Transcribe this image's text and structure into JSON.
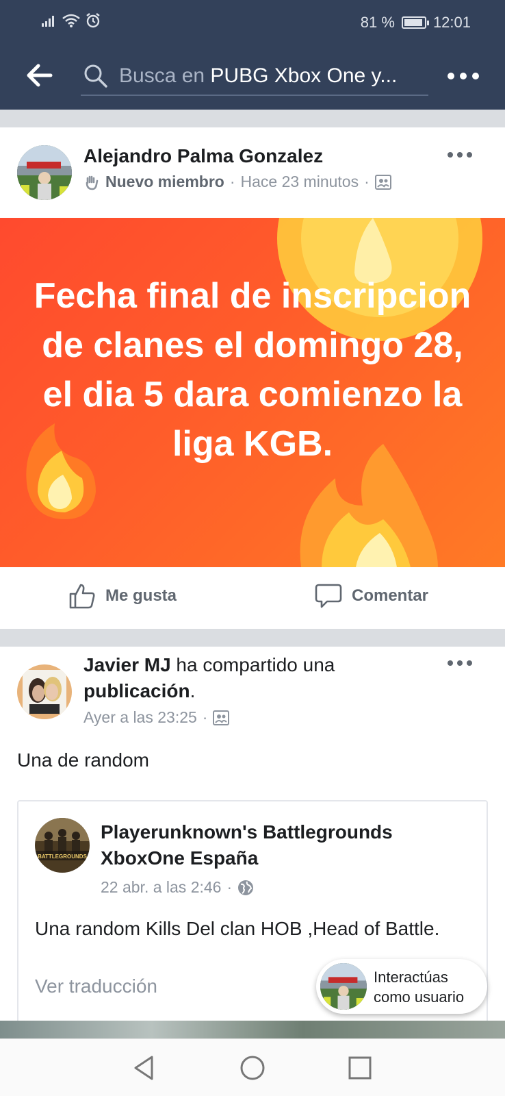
{
  "status_bar": {
    "battery_percent": "81 %",
    "time": "12:01"
  },
  "header": {
    "search_prefix": "Busca en ",
    "search_group": "PUBG Xbox One y...",
    "back_icon": "back-arrow-icon",
    "more_icon": "more-dots-icon"
  },
  "post1": {
    "author": "Alejandro Palma Gonzalez",
    "badge": "Nuevo miembro",
    "time": "Hace 23 minutos",
    "banner_text": "Fecha final de inscripcion de clanes el domingo 28, el dia 5 dara comienzo la liga KGB.",
    "banner_colors": [
      "#ff4a2e",
      "#ff7a25"
    ],
    "like_label": "Me gusta",
    "comment_label": "Comentar"
  },
  "post2": {
    "author": "Javier MJ",
    "action_text": " ha compartido una ",
    "object_text": "publicación",
    "object_suffix": ".",
    "time": "Ayer a las 23:25",
    "body": "Una de random",
    "shared": {
      "page_name": "Playerunknown's Battlegrounds XboxOne España",
      "time": "22 abr. a las 2:46",
      "body": "Una random Kills Del clan HOB ,Head of Battle.",
      "translate_link": "Ver traducción",
      "avatar_text": "BATTLEGROUNDS"
    }
  },
  "interact_pill": {
    "line1": "Interactúas",
    "line2": "como usuario"
  },
  "accent_colors": {
    "header_bg": "#33415a",
    "separator": "#dadde1"
  }
}
